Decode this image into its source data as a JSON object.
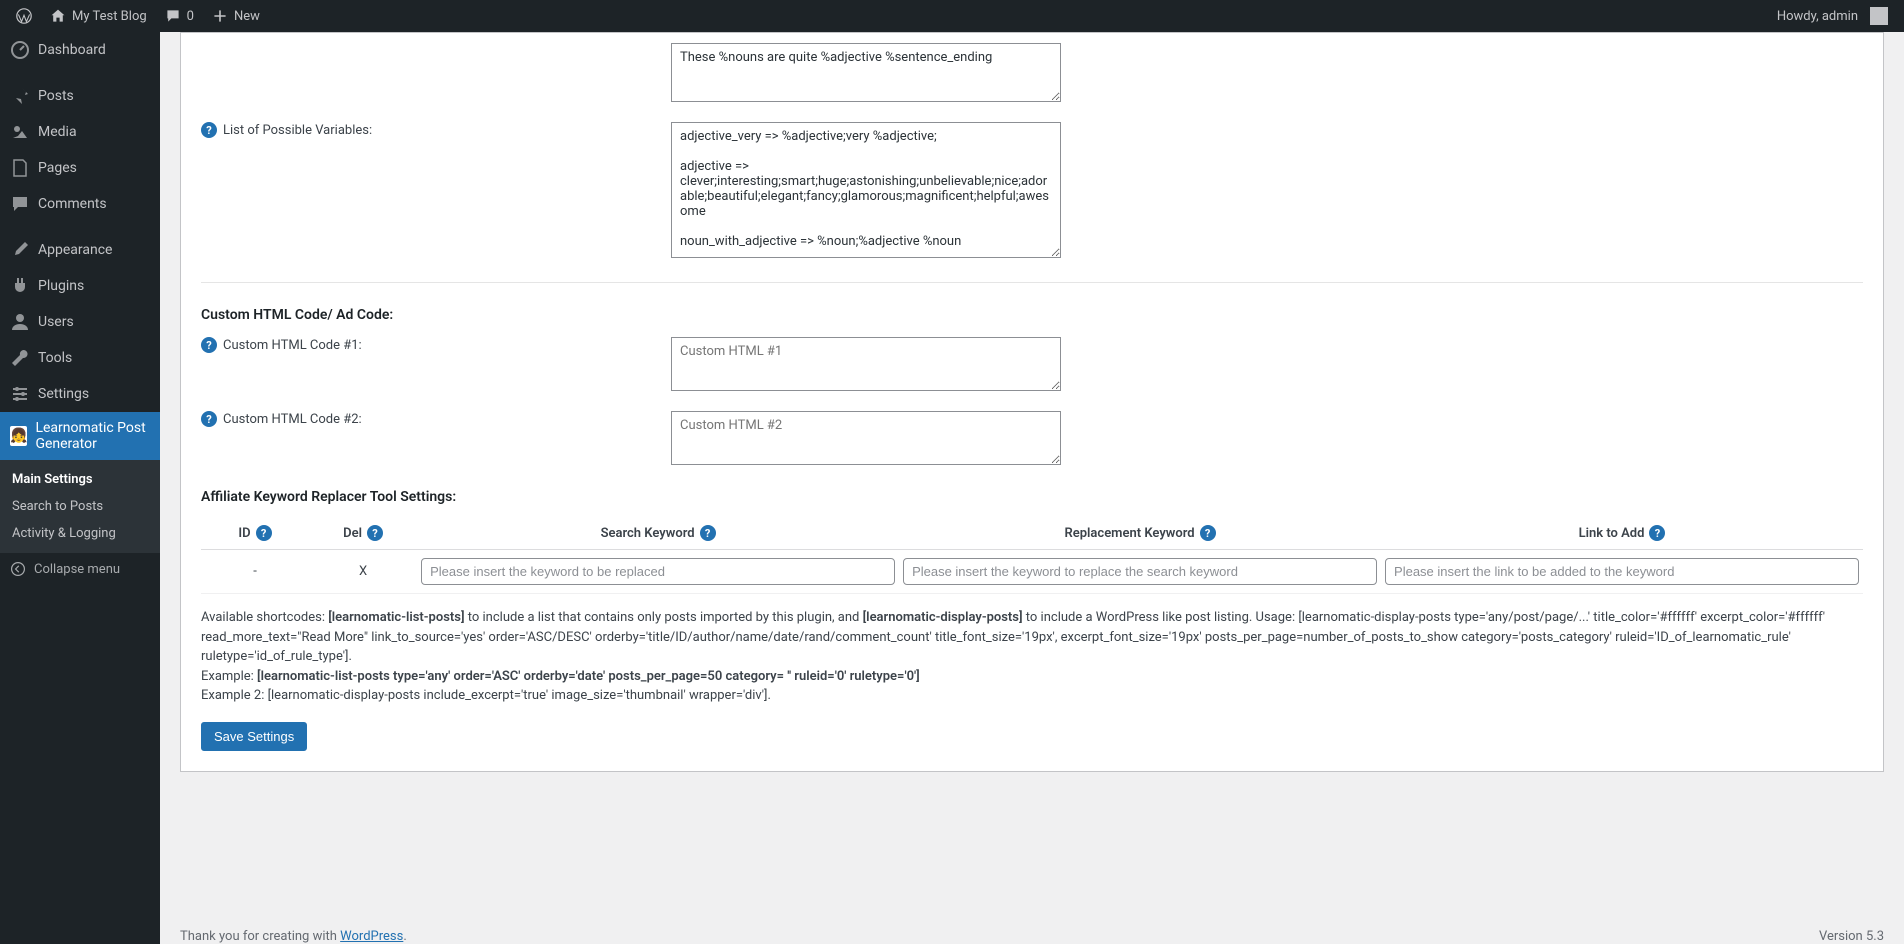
{
  "adminbar": {
    "site_name": "My Test Blog",
    "comments_count": "0",
    "new_label": "New",
    "howdy": "Howdy, admin"
  },
  "sidebar": {
    "items": [
      {
        "label": "Dashboard"
      },
      {
        "label": "Posts"
      },
      {
        "label": "Media"
      },
      {
        "label": "Pages"
      },
      {
        "label": "Comments"
      },
      {
        "label": "Appearance"
      },
      {
        "label": "Plugins"
      },
      {
        "label": "Users"
      },
      {
        "label": "Tools"
      },
      {
        "label": "Settings"
      },
      {
        "label": "Learnomatic Post Generator"
      }
    ],
    "submenu": [
      {
        "label": "Main Settings"
      },
      {
        "label": "Search to Posts"
      },
      {
        "label": "Activity & Logging"
      }
    ],
    "collapse": "Collapse menu"
  },
  "fields": {
    "top_textarea_value": "These %nouns are quite %adjective %sentence_ending",
    "vars_label": "List of Possible Variables:",
    "vars_value": "adjective_very => %adjective;very %adjective;\n\nadjective => clever;interesting;smart;huge;astonishing;unbelievable;nice;adorable;beautiful;elegant;fancy;glamorous;magnificent;helpful;awesome\n\nnoun_with_adjective => %noun;%adjective %noun",
    "custom_section": "Custom HTML Code/ Ad Code:",
    "html1_label": "Custom HTML Code #1:",
    "html1_placeholder": "Custom HTML #1",
    "html2_label": "Custom HTML Code #2:",
    "html2_placeholder": "Custom HTML #2",
    "aff_title": "Affiliate Keyword Replacer Tool Settings:"
  },
  "aff_table": {
    "headers": {
      "id": "ID",
      "del": "Del",
      "search": "Search Keyword",
      "replace": "Replacement Keyword",
      "link": "Link to Add"
    },
    "row": {
      "id": "-",
      "del": "X",
      "search_ph": "Please insert the keyword to be replaced",
      "replace_ph": "Please insert the keyword to replace the search keyword",
      "link_ph": "Please insert the link to be added to the keyword"
    }
  },
  "shortcodes": {
    "pre": "Available shortcodes: ",
    "b1": "[learnomatic-list-posts]",
    "mid1": " to include a list that contains only posts imported by this plugin, and ",
    "b2": "[learnomatic-display-posts]",
    "mid2": " to include a WordPress like post listing. Usage: [learnomatic-display-posts type='any/post/page/...' title_color='#ffffff' excerpt_color='#ffffff' read_more_text=\"Read More\" link_to_source='yes' order='ASC/DESC' orderby='title/ID/author/name/date/rand/comment_count' title_font_size='19px', excerpt_font_size='19px' posts_per_page=number_of_posts_to_show category='posts_category' ruleid='ID_of_learnomatic_rule' ruletype='id_of_rule_type'].",
    "ex1_pre": "Example: ",
    "ex1_b": "[learnomatic-list-posts type='any' order='ASC' orderby='date' posts_per_page=50 category= '' ruleid='0' ruletype='0']",
    "ex2_pre": "Example 2: ",
    "ex2_text": "[learnomatic-display-posts include_excerpt='true' image_size='thumbnail' wrapper='div']."
  },
  "save_label": "Save Settings",
  "footer": {
    "thank_pre": "Thank you for creating with ",
    "wp": "WordPress",
    "dot": ".",
    "version": "Version 5.3"
  }
}
